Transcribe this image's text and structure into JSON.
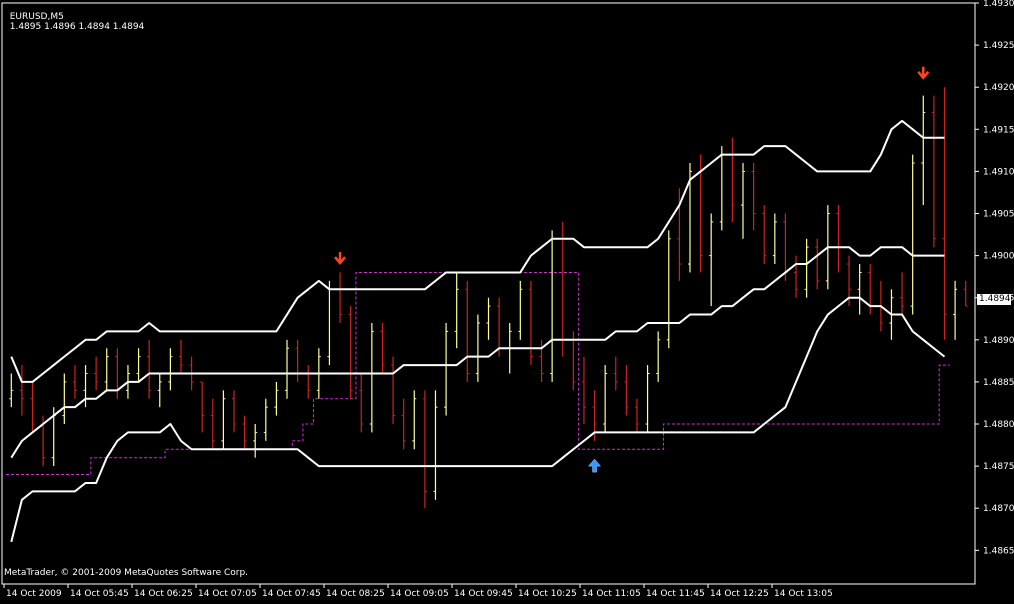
{
  "header": {
    "symbol": "EURUSD,M5",
    "ohlc": "1.4895 1.4896 1.4894 1.4894"
  },
  "footer": {
    "copyright": "MetaTrader, © 2001-2009 MetaQuotes Software Corp."
  },
  "colors": {
    "background": "#000000",
    "axis": "#ffffff",
    "bull_bar": "#ffff99",
    "bear_bar": "#cc2222",
    "doji_bar": "#66cccc",
    "bands": "#ffffff",
    "stop_line": "#cc33cc",
    "sell_arrow": "#ff4422",
    "buy_arrow": "#3399ff"
  },
  "chart_data": {
    "type": "ohlc_bars",
    "symbol": "EURUSD",
    "timeframe": "M5",
    "ylim": [
      1.4861,
      1.493
    ],
    "y_ticks": [
      "1.4930",
      "1.4925",
      "1.4920",
      "1.4915",
      "1.4910",
      "1.4905",
      "1.4900",
      "1.4895",
      "1.4890",
      "1.4885",
      "1.4880",
      "1.4875",
      "1.4870",
      "1.4865"
    ],
    "last_price": "1.4894",
    "x_tick_labels": [
      "14 Oct 2009",
      "14 Oct 05:45",
      "14 Oct 06:25",
      "14 Oct 07:05",
      "14 Oct 07:45",
      "14 Oct 08:25",
      "14 Oct 09:05",
      "14 Oct 09:45",
      "14 Oct 10:25",
      "14 Oct 11:05",
      "14 Oct 11:45",
      "14 Oct 12:25",
      "14 Oct 13:05"
    ],
    "bars": [
      [
        1.4883,
        1.4886,
        1.4882,
        1.4884
      ],
      [
        1.4884,
        1.4887,
        1.4881,
        1.4883
      ],
      [
        1.4883,
        1.4885,
        1.4879,
        1.488
      ],
      [
        1.488,
        1.4881,
        1.4875,
        1.4876
      ],
      [
        1.4876,
        1.4882,
        1.4875,
        1.4881
      ],
      [
        1.4881,
        1.4886,
        1.488,
        1.4885
      ],
      [
        1.4885,
        1.4887,
        1.4883,
        1.4884
      ],
      [
        1.4884,
        1.4887,
        1.4882,
        1.4886
      ],
      [
        1.4886,
        1.4888,
        1.4884,
        1.4885
      ],
      [
        1.4885,
        1.4889,
        1.4884,
        1.4888
      ],
      [
        1.4888,
        1.4889,
        1.4883,
        1.4884
      ],
      [
        1.4884,
        1.4887,
        1.4883,
        1.4886
      ],
      [
        1.4886,
        1.4889,
        1.4885,
        1.4888
      ],
      [
        1.4888,
        1.489,
        1.4883,
        1.4884
      ],
      [
        1.4884,
        1.4886,
        1.4882,
        1.4885
      ],
      [
        1.4885,
        1.4889,
        1.4884,
        1.4888
      ],
      [
        1.4888,
        1.489,
        1.4886,
        1.4887
      ],
      [
        1.4887,
        1.4888,
        1.4884,
        1.4885
      ],
      [
        1.4885,
        1.4885,
        1.4879,
        1.4881
      ],
      [
        1.4881,
        1.4883,
        1.4877,
        1.4878
      ],
      [
        1.4878,
        1.4884,
        1.4877,
        1.4883
      ],
      [
        1.4883,
        1.4884,
        1.4879,
        1.488
      ],
      [
        1.488,
        1.4881,
        1.4877,
        1.4878
      ],
      [
        1.4878,
        1.488,
        1.4876,
        1.4879
      ],
      [
        1.4879,
        1.4883,
        1.4878,
        1.4882
      ],
      [
        1.4882,
        1.4885,
        1.4881,
        1.4884
      ],
      [
        1.4884,
        1.489,
        1.4883,
        1.4889
      ],
      [
        1.4889,
        1.489,
        1.4885,
        1.4886
      ],
      [
        1.4886,
        1.4887,
        1.4883,
        1.4884
      ],
      [
        1.4884,
        1.4889,
        1.4883,
        1.4888
      ],
      [
        1.4888,
        1.4897,
        1.4887,
        1.4896
      ],
      [
        1.4896,
        1.4898,
        1.4892,
        1.4893
      ],
      [
        1.4893,
        1.4894,
        1.4883,
        1.4884
      ],
      [
        1.4884,
        1.4886,
        1.4879,
        1.488
      ],
      [
        1.488,
        1.4892,
        1.4879,
        1.4891
      ],
      [
        1.4891,
        1.4892,
        1.4886,
        1.4887
      ],
      [
        1.4887,
        1.4888,
        1.488,
        1.4881
      ],
      [
        1.4881,
        1.4883,
        1.4877,
        1.4878
      ],
      [
        1.4878,
        1.4884,
        1.4877,
        1.4883
      ],
      [
        1.4883,
        1.4884,
        1.487,
        1.4872
      ],
      [
        1.4872,
        1.4884,
        1.4871,
        1.4882
      ],
      [
        1.4882,
        1.4892,
        1.4881,
        1.4891
      ],
      [
        1.4891,
        1.4898,
        1.4889,
        1.4896
      ],
      [
        1.4896,
        1.4897,
        1.4885,
        1.4886
      ],
      [
        1.4886,
        1.4893,
        1.4885,
        1.4892
      ],
      [
        1.4892,
        1.4895,
        1.489,
        1.4894
      ],
      [
        1.4894,
        1.4895,
        1.4888,
        1.4889
      ],
      [
        1.4889,
        1.4892,
        1.4886,
        1.4891
      ],
      [
        1.4891,
        1.4897,
        1.489,
        1.4896
      ],
      [
        1.4896,
        1.4897,
        1.4887,
        1.4888
      ],
      [
        1.4888,
        1.489,
        1.4885,
        1.4886
      ],
      [
        1.4886,
        1.4903,
        1.4885,
        1.4902
      ],
      [
        1.4902,
        1.4904,
        1.4888,
        1.489
      ],
      [
        1.489,
        1.4891,
        1.4884,
        1.4885
      ],
      [
        1.4885,
        1.4888,
        1.488,
        1.4882
      ],
      [
        1.4882,
        1.4884,
        1.4878,
        1.488
      ],
      [
        1.488,
        1.4887,
        1.4879,
        1.4886
      ],
      [
        1.4886,
        1.4888,
        1.4884,
        1.4885
      ],
      [
        1.4885,
        1.4887,
        1.4881,
        1.4882
      ],
      [
        1.4882,
        1.4883,
        1.4879,
        1.488
      ],
      [
        1.488,
        1.4887,
        1.4879,
        1.4886
      ],
      [
        1.4886,
        1.4891,
        1.4885,
        1.489
      ],
      [
        1.489,
        1.4903,
        1.4889,
        1.4902
      ],
      [
        1.4902,
        1.4908,
        1.4897,
        1.4899
      ],
      [
        1.4899,
        1.4911,
        1.4898,
        1.491
      ],
      [
        1.491,
        1.4912,
        1.4898,
        1.49
      ],
      [
        1.49,
        1.4905,
        1.4894,
        1.4904
      ],
      [
        1.4904,
        1.4913,
        1.4903,
        1.4912
      ],
      [
        1.4912,
        1.4914,
        1.4904,
        1.4906
      ],
      [
        1.4906,
        1.4911,
        1.4902,
        1.491
      ],
      [
        1.491,
        1.4911,
        1.4903,
        1.4905
      ],
      [
        1.4905,
        1.4906,
        1.4899,
        1.49
      ],
      [
        1.49,
        1.4905,
        1.4899,
        1.4904
      ],
      [
        1.4904,
        1.4905,
        1.4897,
        1.4898
      ],
      [
        1.4898,
        1.49,
        1.4895,
        1.4896
      ],
      [
        1.4896,
        1.4902,
        1.4895,
        1.4901
      ],
      [
        1.4901,
        1.4902,
        1.4896,
        1.4897
      ],
      [
        1.4897,
        1.4906,
        1.4896,
        1.4905
      ],
      [
        1.4905,
        1.4906,
        1.4898,
        1.4899
      ],
      [
        1.4899,
        1.49,
        1.4894,
        1.4896
      ],
      [
        1.4896,
        1.4899,
        1.4893,
        1.4898
      ],
      [
        1.4898,
        1.4899,
        1.4893,
        1.4894
      ],
      [
        1.4894,
        1.4897,
        1.4891,
        1.4892
      ],
      [
        1.4892,
        1.4896,
        1.489,
        1.4895
      ],
      [
        1.4895,
        1.4898,
        1.4893,
        1.4894
      ],
      [
        1.4894,
        1.4912,
        1.4893,
        1.4911
      ],
      [
        1.4911,
        1.4919,
        1.4906,
        1.4917
      ],
      [
        1.4917,
        1.4919,
        1.4901,
        1.4902
      ],
      [
        1.4902,
        1.492,
        1.489,
        1.4893
      ],
      [
        1.4893,
        1.4897,
        1.489,
        1.4896
      ],
      [
        1.4896,
        1.4897,
        1.4894,
        1.4894
      ]
    ],
    "upper_band": [
      1.4888,
      1.4885,
      1.4885,
      1.4886,
      1.4887,
      1.4888,
      1.4889,
      1.489,
      1.489,
      1.4891,
      1.4891,
      1.4891,
      1.4891,
      1.4892,
      1.4891,
      1.4891,
      1.4891,
      1.4891,
      1.4891,
      1.4891,
      1.4891,
      1.4891,
      1.4891,
      1.4891,
      1.4891,
      1.4891,
      1.4893,
      1.4895,
      1.4896,
      1.4897,
      1.4896,
      1.4896,
      1.4896,
      1.4896,
      1.4896,
      1.4896,
      1.4896,
      1.4896,
      1.4896,
      1.4896,
      1.4897,
      1.4898,
      1.4898,
      1.4898,
      1.4898,
      1.4898,
      1.4898,
      1.4898,
      1.4898,
      1.49,
      1.4901,
      1.4902,
      1.4902,
      1.4902,
      1.4901,
      1.4901,
      1.4901,
      1.4901,
      1.4901,
      1.4901,
      1.4901,
      1.4902,
      1.4904,
      1.4906,
      1.4909,
      1.491,
      1.4911,
      1.4912,
      1.4912,
      1.4912,
      1.4912,
      1.4913,
      1.4913,
      1.4913,
      1.4912,
      1.4911,
      1.491,
      1.491,
      1.491,
      1.491,
      1.491,
      1.491,
      1.4912,
      1.4915,
      1.4916,
      1.4915,
      1.4914,
      1.4914,
      1.4914
    ],
    "middle_band": [
      1.4876,
      1.4878,
      1.4879,
      1.488,
      1.4881,
      1.4882,
      1.4882,
      1.4883,
      1.4883,
      1.4884,
      1.4884,
      1.4885,
      1.4885,
      1.4886,
      1.4886,
      1.4886,
      1.4886,
      1.4886,
      1.4886,
      1.4886,
      1.4886,
      1.4886,
      1.4886,
      1.4886,
      1.4886,
      1.4886,
      1.4886,
      1.4886,
      1.4886,
      1.4886,
      1.4886,
      1.4886,
      1.4886,
      1.4886,
      1.4886,
      1.4886,
      1.4886,
      1.4887,
      1.4887,
      1.4887,
      1.4887,
      1.4887,
      1.4887,
      1.4888,
      1.4888,
      1.4888,
      1.4889,
      1.4889,
      1.4889,
      1.4889,
      1.4889,
      1.489,
      1.489,
      1.489,
      1.489,
      1.489,
      1.489,
      1.4891,
      1.4891,
      1.4891,
      1.4892,
      1.4892,
      1.4892,
      1.4892,
      1.4893,
      1.4893,
      1.4893,
      1.4894,
      1.4894,
      1.4895,
      1.4896,
      1.4896,
      1.4897,
      1.4898,
      1.4899,
      1.4899,
      1.49,
      1.4901,
      1.4901,
      1.4901,
      1.49,
      1.49,
      1.4901,
      1.4901,
      1.4901,
      1.49,
      1.49,
      1.49,
      1.49
    ],
    "lower_band": [
      1.4866,
      1.4871,
      1.4872,
      1.4872,
      1.4872,
      1.4872,
      1.4872,
      1.4873,
      1.4873,
      1.4876,
      1.4878,
      1.4879,
      1.4879,
      1.4879,
      1.4879,
      1.488,
      1.4878,
      1.4877,
      1.4877,
      1.4877,
      1.4877,
      1.4877,
      1.4877,
      1.4877,
      1.4877,
      1.4877,
      1.4877,
      1.4877,
      1.4876,
      1.4875,
      1.4875,
      1.4875,
      1.4875,
      1.4875,
      1.4875,
      1.4875,
      1.4875,
      1.4875,
      1.4875,
      1.4875,
      1.4875,
      1.4875,
      1.4875,
      1.4875,
      1.4875,
      1.4875,
      1.4875,
      1.4875,
      1.4875,
      1.4875,
      1.4875,
      1.4875,
      1.4876,
      1.4877,
      1.4878,
      1.4879,
      1.4879,
      1.4879,
      1.4879,
      1.4879,
      1.4879,
      1.4879,
      1.4879,
      1.4879,
      1.4879,
      1.4879,
      1.4879,
      1.4879,
      1.4879,
      1.4879,
      1.4879,
      1.488,
      1.4881,
      1.4882,
      1.4885,
      1.4888,
      1.4891,
      1.4893,
      1.4894,
      1.4895,
      1.4895,
      1.4894,
      1.4894,
      1.4893,
      1.4893,
      1.4891,
      1.489,
      1.4889,
      1.4888
    ],
    "stop_line": [
      1.4874,
      1.4874,
      1.4874,
      1.4874,
      1.4874,
      1.4874,
      1.4874,
      1.4874,
      1.4876,
      1.4876,
      1.4876,
      1.4876,
      1.4876,
      1.4876,
      1.4876,
      1.4877,
      1.4877,
      1.4877,
      1.4877,
      1.4877,
      1.4877,
      1.4877,
      1.4877,
      1.4877,
      1.4877,
      1.4877,
      1.4877,
      1.4878,
      1.488,
      1.4883,
      1.4883,
      1.4883,
      1.4883,
      1.4898,
      1.4898,
      1.4898,
      1.4898,
      1.4898,
      1.4898,
      1.4898,
      1.4898,
      1.4898,
      1.4898,
      1.4898,
      1.4898,
      1.4898,
      1.4898,
      1.4898,
      1.4898,
      1.4898,
      1.4898,
      1.4898,
      1.4898,
      1.4898,
      1.4877,
      1.4877,
      1.4877,
      1.4877,
      1.4877,
      1.4877,
      1.4877,
      1.4877,
      1.488,
      1.488,
      1.488,
      1.488,
      1.488,
      1.488,
      1.488,
      1.488,
      1.488,
      1.488,
      1.488,
      1.488,
      1.488,
      1.488,
      1.488,
      1.488,
      1.488,
      1.488,
      1.488,
      1.488,
      1.488,
      1.488,
      1.488,
      1.488,
      1.488,
      1.488,
      1.4887
    ],
    "signals": [
      {
        "type": "sell",
        "bar": 31,
        "price": 1.4899
      },
      {
        "type": "buy",
        "bar": 55,
        "price": 1.4875
      },
      {
        "type": "sell",
        "bar": 86,
        "price": 1.4921
      }
    ]
  }
}
